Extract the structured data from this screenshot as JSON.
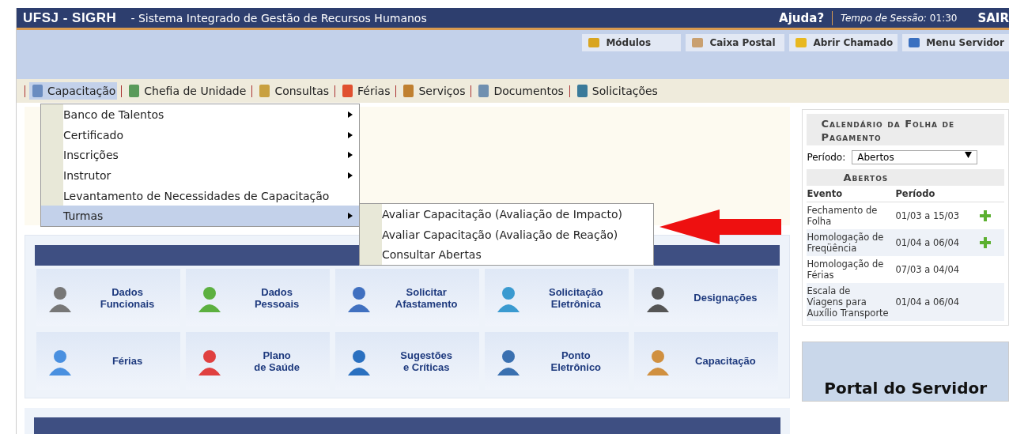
{
  "header": {
    "brand": "UFSJ - SIGRH",
    "subtitle": "- Sistema Integrado de Gestão de Recursos Humanos",
    "help": "Ajuda?",
    "session_label": "Tempo de Sessão:",
    "session_time": "01:30",
    "logout": "SAIR"
  },
  "toolbar": [
    "Módulos",
    "Caixa Postal",
    "Abrir Chamado",
    "Menu Servidor"
  ],
  "menu": [
    {
      "label": "Capacitação",
      "selected": true
    },
    {
      "label": "Chefia de Unidade",
      "selected": false
    },
    {
      "label": "Consultas",
      "selected": false
    },
    {
      "label": "Férias",
      "selected": false
    },
    {
      "label": "Serviços",
      "selected": false
    },
    {
      "label": "Documentos",
      "selected": false
    },
    {
      "label": "Solicitações",
      "selected": false
    }
  ],
  "dropdown": [
    {
      "label": "Banco de Talentos",
      "has_submenu": true,
      "selected": false
    },
    {
      "label": "Certificado",
      "has_submenu": true,
      "selected": false
    },
    {
      "label": "Inscrições",
      "has_submenu": true,
      "selected": false
    },
    {
      "label": "Instrutor",
      "has_submenu": true,
      "selected": false
    },
    {
      "label": "Levantamento de Necessidades de Capacitação",
      "has_submenu": false,
      "selected": false
    },
    {
      "label": "Turmas",
      "has_submenu": true,
      "selected": true
    }
  ],
  "submenu": [
    "Avaliar Capacitação (Avaliação de Impacto)",
    "Avaliar Capacitação (Avaliação de Reação)",
    "Consultar Abertas"
  ],
  "shortcuts": [
    {
      "lines": [
        "Dados",
        "Funcionais"
      ]
    },
    {
      "lines": [
        "Dados",
        "Pessoais"
      ]
    },
    {
      "lines": [
        "Solicitar",
        "Afastamento"
      ]
    },
    {
      "lines": [
        "Solicitação",
        "Eletrônica"
      ]
    },
    {
      "lines": [
        "Designações"
      ]
    },
    {
      "lines": [
        "Férias"
      ]
    },
    {
      "lines": [
        "Plano",
        "de Saúde"
      ]
    },
    {
      "lines": [
        "Sugestões",
        "e Críticas"
      ]
    },
    {
      "lines": [
        "Ponto",
        "Eletrônico"
      ]
    },
    {
      "lines": [
        "Capacitação"
      ]
    }
  ],
  "calendar": {
    "title": "Calendário da Folha de Pagamento",
    "period_label": "Período:",
    "period_value": "Abertos",
    "section": "Abertos",
    "columns": [
      "Evento",
      "Período"
    ],
    "rows": [
      {
        "event": "Fechamento de Folha",
        "period": "01/03 a 15/03",
        "addable": true
      },
      {
        "event": "Homologação de Freqüência",
        "period": "01/04 a 06/04",
        "addable": true
      },
      {
        "event": "Homologação de Férias",
        "period": "07/03 a 04/04",
        "addable": false
      },
      {
        "event": "Escala de Viagens para Auxílio Transporte",
        "period": "01/04 a 06/04",
        "addable": false
      }
    ]
  },
  "portal": {
    "title": "Portal do Servidor"
  }
}
